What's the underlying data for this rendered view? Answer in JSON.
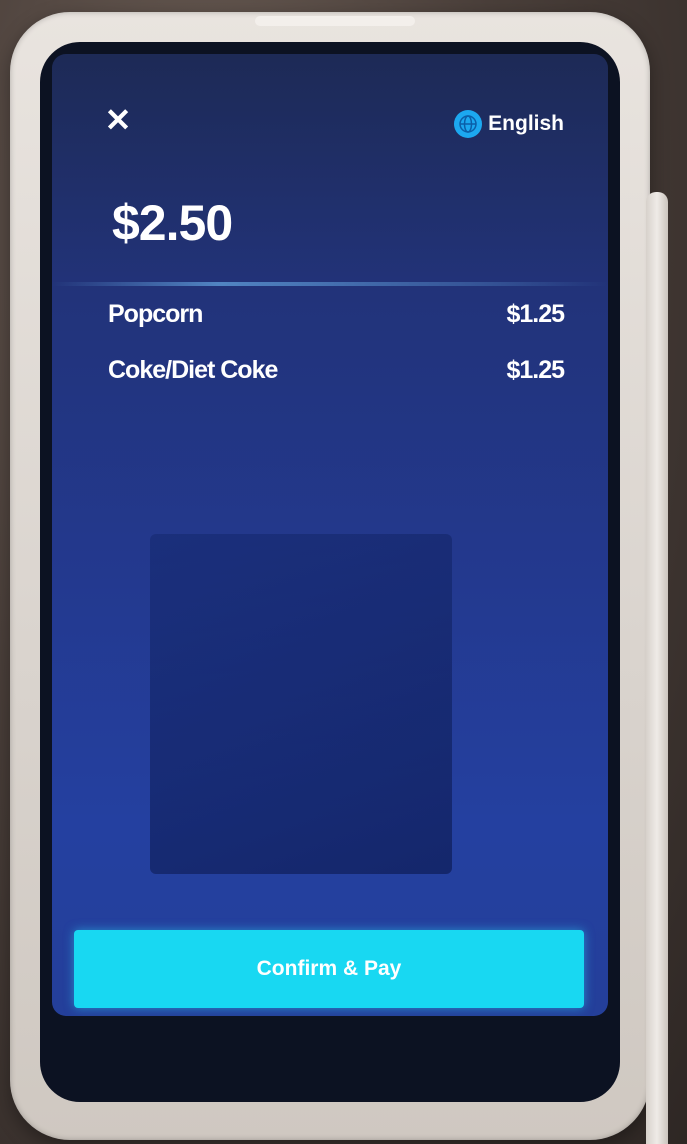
{
  "header": {
    "close_icon": "close-icon",
    "language_label": "English",
    "language_icon": "globe-icon"
  },
  "order": {
    "total": "$2.50",
    "items": [
      {
        "name": "Popcorn",
        "price": "$1.25"
      },
      {
        "name": "Coke/Diet Coke",
        "price": "$1.25"
      }
    ]
  },
  "actions": {
    "confirm_label": "Confirm & Pay"
  },
  "colors": {
    "screen_bg": "#22337a",
    "accent": "#18d8f2",
    "globe": "#1ca8f0"
  }
}
